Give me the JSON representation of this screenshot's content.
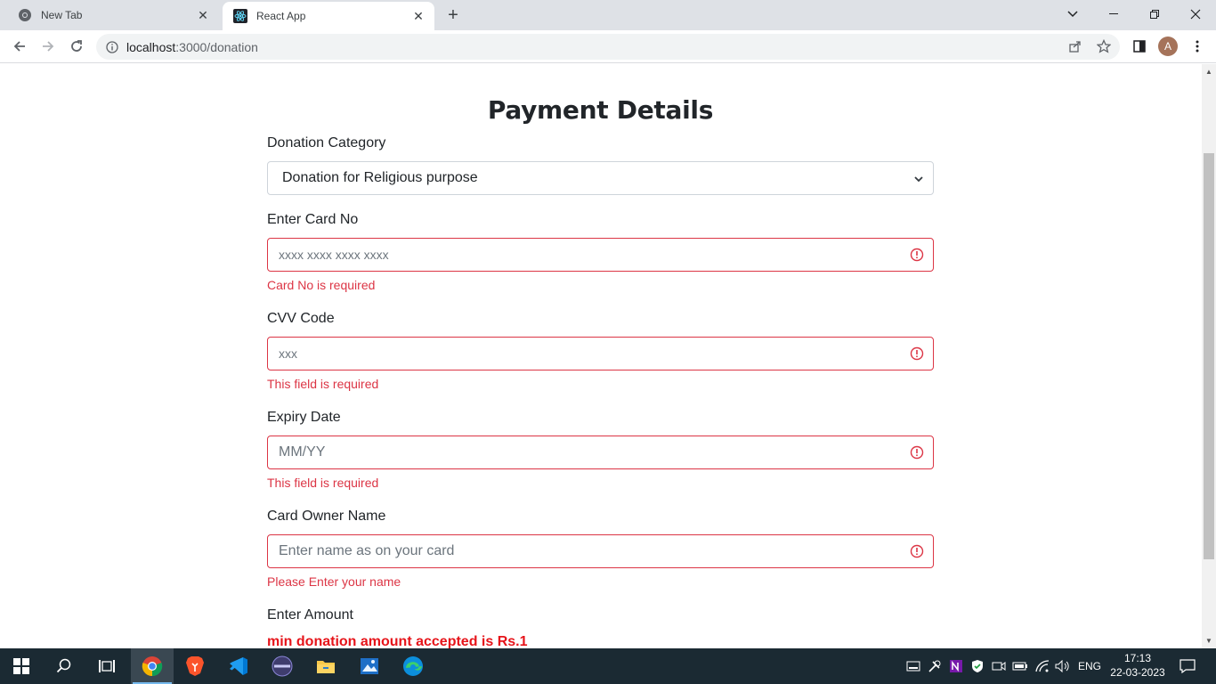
{
  "browser": {
    "tabs": [
      {
        "title": "New Tab",
        "icon": "chrome-icon"
      },
      {
        "title": "React App",
        "icon": "react-icon"
      }
    ],
    "address": {
      "host": "localhost",
      "rest": ":3000/donation"
    },
    "profile_initial": "A"
  },
  "form": {
    "title": "Payment Details",
    "category": {
      "label": "Donation Category",
      "selected": "Donation for Religious purpose"
    },
    "card_no": {
      "label": "Enter Card No",
      "placeholder": "xxxx xxxx xxxx xxxx",
      "error": "Card No is required"
    },
    "cvv": {
      "label": "CVV Code",
      "placeholder": "xxx",
      "error": "This field is required"
    },
    "expiry": {
      "label": "Expiry Date",
      "placeholder": "MM/YY",
      "error": "This field is required"
    },
    "owner": {
      "label": "Card Owner Name",
      "placeholder": "Enter name as on your card",
      "error": "Please Enter your name"
    },
    "amount": {
      "label": "Enter Amount",
      "warning": "min donation amount accepted is Rs.1"
    }
  },
  "taskbar": {
    "language": "ENG",
    "time": "17:13",
    "date": "22-03-2023"
  },
  "colors": {
    "error": "#dc3545",
    "warning": "#e6141a",
    "taskbar": "#1b2a33"
  }
}
